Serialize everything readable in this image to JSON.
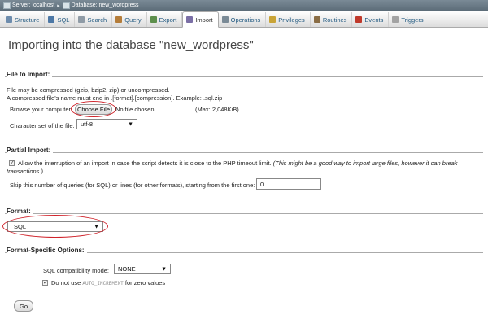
{
  "breadcrumb": {
    "server_label": "Server: localhost",
    "db_label": "Database: new_wordpress"
  },
  "tabs": [
    {
      "label": "Structure",
      "icon": "structure-icon",
      "color": "#6d8cad"
    },
    {
      "label": "SQL",
      "icon": "sql-icon",
      "color": "#4d78a6"
    },
    {
      "label": "Search",
      "icon": "search-icon",
      "color": "#8f9ba6"
    },
    {
      "label": "Query",
      "icon": "query-icon",
      "color": "#b57d3a"
    },
    {
      "label": "Export",
      "icon": "export-icon",
      "color": "#5d8f4c"
    },
    {
      "label": "Import",
      "icon": "import-icon",
      "color": "#7b6fa6"
    },
    {
      "label": "Operations",
      "icon": "operations-icon",
      "color": "#7a8a96"
    },
    {
      "label": "Privileges",
      "icon": "privileges-icon",
      "color": "#c9a437"
    },
    {
      "label": "Routines",
      "icon": "routines-icon",
      "color": "#8a6d45"
    },
    {
      "label": "Events",
      "icon": "events-icon",
      "color": "#c0392b"
    },
    {
      "label": "Triggers",
      "icon": "triggers-icon",
      "color": "#a3a3a3"
    }
  ],
  "active_tab": "Import",
  "page_title": "Importing into the database \"new_wordpress\"",
  "file_section": {
    "legend": "File to Import:",
    "line1": "File may be compressed (gzip, bzip2, zip) or uncompressed.",
    "line2": "A compressed file's name must end in .[format].[compression]. Example: .sql.zip",
    "browse_label": "Browse your computer:",
    "choose_file_label": "Choose File",
    "no_file_text": "No file chosen",
    "max_size": "(Max: 2,048KiB)",
    "charset_label": "Character set of the file:",
    "charset_value": "utf-8"
  },
  "partial_section": {
    "legend": "Partial Import:",
    "allow_interrupt_text": "Allow the interruption of an import in case the script detects it is close to the PHP timeout limit.",
    "allow_interrupt_note_1": "(This might be a good way to import large files, however it can break",
    "allow_interrupt_note_2": "transactions.)",
    "allow_interrupt_checked": true,
    "skip_label": "Skip this number of queries (for SQL) or lines (for other formats), starting from the first one:",
    "skip_value": "0"
  },
  "format_section": {
    "legend": "Format:",
    "format_value": "SQL"
  },
  "options_section": {
    "legend": "Format-Specific Options:",
    "compat_label": "SQL compatibility mode:",
    "compat_value": "NONE",
    "auto_value_pre": "Do not use",
    "auto_value_code": "AUTO_INCREMENT",
    "auto_value_post": "for zero values",
    "auto_value_checked": true
  },
  "go_label": "Go",
  "highlight_color": "#d0232b"
}
